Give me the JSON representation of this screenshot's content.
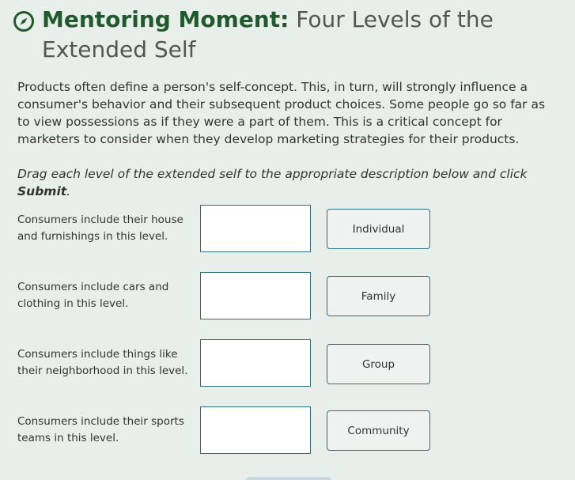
{
  "header": {
    "title_strong": "Mentoring Moment:",
    "title_rest": " Four Levels of the Extended Self",
    "icon": "compass-icon",
    "icon_color": "#1e5a2c"
  },
  "intro": "Products often define a person's self-concept. This, in turn, will strongly influence a consumer's behavior and their subsequent product choices. Some people go so far as to view possessions as if they were a part of them. This is a critical concept for marketers to consider when they develop marketing strategies for their products.",
  "instruction": {
    "before": "Drag each level of the extended self to the appropriate description below and click ",
    "bold": "Submit",
    "after": "."
  },
  "rows": [
    {
      "description": "Consumers include their house and furnishings in this level."
    },
    {
      "description": "Consumers include cars and clothing in this level."
    },
    {
      "description": "Consumers include things like their neighborhood in this level."
    },
    {
      "description": "Consumers include their sports teams in this level."
    }
  ],
  "drag_items": [
    "Individual",
    "Family",
    "Group",
    "Community"
  ],
  "colors": {
    "background": "#e8efea",
    "accent": "#1e5a2c",
    "border": "#2a6f86"
  }
}
